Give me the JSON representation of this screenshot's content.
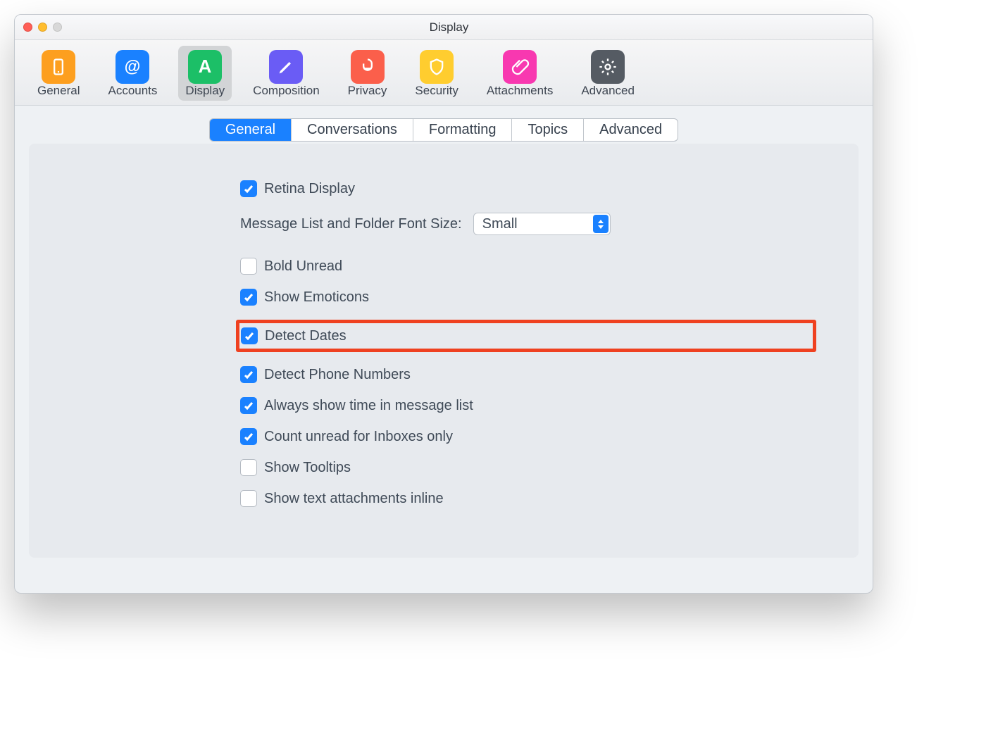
{
  "window": {
    "title": "Display"
  },
  "toolbar": {
    "items": [
      {
        "label": "General",
        "color": "#fd9f1f",
        "icon": "phone"
      },
      {
        "label": "Accounts",
        "color": "#1a81ff",
        "icon": "at"
      },
      {
        "label": "Display",
        "color": "#1cbf67",
        "icon": "A"
      },
      {
        "label": "Composition",
        "color": "#6a5cf5",
        "icon": "pencil"
      },
      {
        "label": "Privacy",
        "color": "#fb5f4b",
        "icon": "lock"
      },
      {
        "label": "Security",
        "color": "#ffcd2f",
        "icon": "shield"
      },
      {
        "label": "Attachments",
        "color": "#f838b0",
        "icon": "clip"
      },
      {
        "label": "Advanced",
        "color": "#555b63",
        "icon": "gear"
      }
    ],
    "selectedIndex": 2
  },
  "tabs": {
    "items": [
      "General",
      "Conversations",
      "Formatting",
      "Topics",
      "Advanced"
    ],
    "activeIndex": 0
  },
  "settings": {
    "retina": {
      "label": "Retina Display",
      "checked": true
    },
    "fontRow": {
      "label": "Message List and Folder Font Size:",
      "value": "Small"
    },
    "bold": {
      "label": "Bold Unread",
      "checked": false
    },
    "emoti": {
      "label": "Show Emoticons",
      "checked": true
    },
    "dates": {
      "label": "Detect Dates",
      "checked": true
    },
    "phone": {
      "label": "Detect Phone Numbers",
      "checked": true
    },
    "time": {
      "label": "Always show time in message list",
      "checked": true
    },
    "count": {
      "label": "Count unread for Inboxes only",
      "checked": true
    },
    "tooltips": {
      "label": "Show Tooltips",
      "checked": false
    },
    "inline": {
      "label": "Show text attachments inline",
      "checked": false
    }
  },
  "highlightKey": "dates"
}
